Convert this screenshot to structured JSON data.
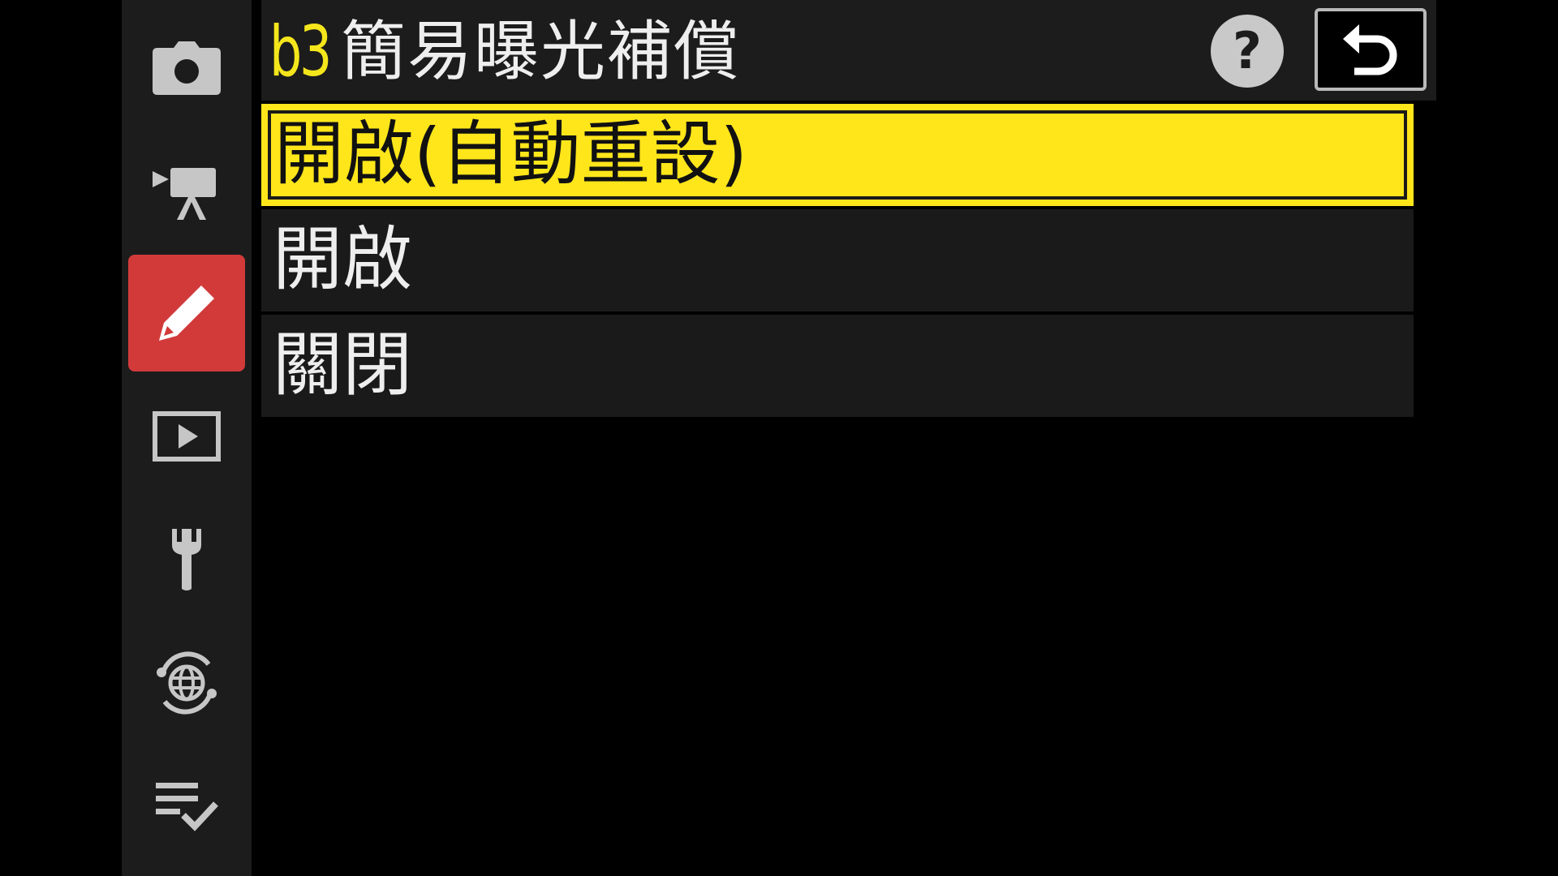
{
  "sidebar": {
    "tabs": [
      {
        "icon": "camera-icon",
        "active": false
      },
      {
        "icon": "movie-camera-icon",
        "active": false
      },
      {
        "icon": "pencil-icon",
        "active": true
      },
      {
        "icon": "playback-icon",
        "active": false
      },
      {
        "icon": "wrench-icon",
        "active": false
      },
      {
        "icon": "network-icon",
        "active": false
      },
      {
        "icon": "my-menu-icon",
        "active": false
      }
    ]
  },
  "header": {
    "code": "b3",
    "title": "簡易曝光補償",
    "help_label": "?"
  },
  "menu": {
    "options": [
      {
        "label": "開啟(自動重設)",
        "selected": true
      },
      {
        "label": "開啟",
        "selected": false
      },
      {
        "label": "關閉",
        "selected": false
      }
    ]
  },
  "colors": {
    "accent_yellow": "#ffe61a",
    "active_tab_red": "#d23a3a",
    "panel_bg": "#1c1c1c"
  }
}
